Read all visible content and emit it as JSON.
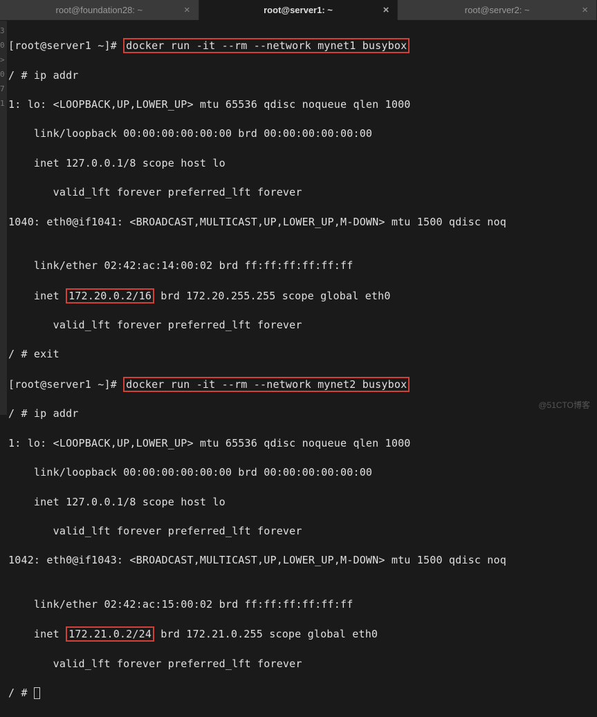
{
  "tabs": [
    {
      "label": "root@foundation28: ~",
      "active": false
    },
    {
      "label": "root@server1: ~",
      "active": true
    },
    {
      "label": "root@server2: ~",
      "active": false
    }
  ],
  "leftStrip": [
    "",
    "",
    "",
    "",
    "",
    "",
    "3",
    "",
    "",
    "0",
    "",
    ">",
    "0",
    "",
    "7",
    "",
    "1",
    "",
    "",
    "",
    "",
    "",
    "",
    "",
    "",
    ""
  ],
  "session1": {
    "prompt": "[root@server1 ~]# ",
    "command_hl": "docker run -it --rm --network mynet1 busybox",
    "l2": "/ # ip addr",
    "l3": "1: lo: <LOOPBACK,UP,LOWER_UP> mtu 65536 qdisc noqueue qlen 1000",
    "l4": "    link/loopback 00:00:00:00:00:00 brd 00:00:00:00:00:00",
    "l5": "    inet 127.0.0.1/8 scope host lo",
    "l6": "       valid_lft forever preferred_lft forever",
    "l7": "1040: eth0@if1041: <BROADCAST,MULTICAST,UP,LOWER_UP,M-DOWN> mtu 1500 qdisc noq",
    "l8": "",
    "l9a": "    link/ether 02:42:ac:14:00:02 brd ff:ff:ff:ff:ff:ff",
    "l10a": "    inet ",
    "l10hl": "172.20.0.2/16",
    "l10b": " brd 172.20.255.255 scope global eth0",
    "l11": "       valid_lft forever preferred_lft forever",
    "l12": "/ # exit"
  },
  "session2": {
    "prompt": "[root@server1 ~]# ",
    "command_hl": "docker run -it --rm --network mynet2 busybox",
    "l2": "/ # ip addr",
    "l3": "1: lo: <LOOPBACK,UP,LOWER_UP> mtu 65536 qdisc noqueue qlen 1000",
    "l4": "    link/loopback 00:00:00:00:00:00 brd 00:00:00:00:00:00",
    "l5": "    inet 127.0.0.1/8 scope host lo",
    "l6": "       valid_lft forever preferred_lft forever",
    "l7": "1042: eth0@if1043: <BROADCAST,MULTICAST,UP,LOWER_UP,M-DOWN> mtu 1500 qdisc noq",
    "l8": "",
    "l9a": "    link/ether 02:42:ac:15:00:02 brd ff:ff:ff:ff:ff:ff",
    "l10a": "    inet ",
    "l10hl": "172.21.0.2/24",
    "l10b": " brd 172.21.0.255 scope global eth0",
    "l11": "       valid_lft forever preferred_lft forever",
    "l12": "/ # "
  },
  "watermark": "@51CTO博客"
}
